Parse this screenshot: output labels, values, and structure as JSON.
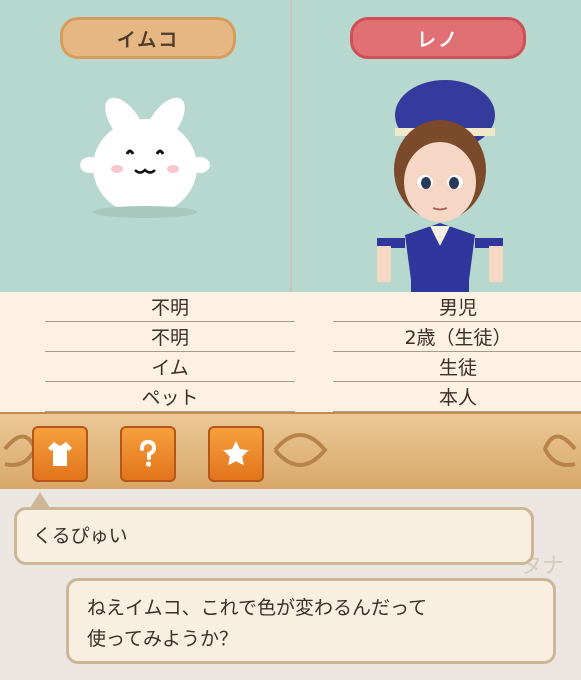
{
  "characters": {
    "left": {
      "name": "イムコ",
      "info": [
        "不明",
        "不明",
        "イム",
        "ペット"
      ]
    },
    "right": {
      "name": "レノ",
      "info": [
        "男児",
        "2歳（生徒）",
        "生徒",
        "本人"
      ]
    }
  },
  "toolbar": {
    "buttons": [
      {
        "name": "outfit-button",
        "icon": "shirt-icon"
      },
      {
        "name": "question-button",
        "icon": "question-icon"
      },
      {
        "name": "favorite-button",
        "icon": "star-icon"
      }
    ]
  },
  "chat": {
    "messages": [
      "くるぴゅい",
      "ねえイムコ、これで色が変わるんだって",
      "使ってみようか？"
    ],
    "watermark": "タナ"
  },
  "colors": {
    "panel_bg": "#b7d8ce",
    "left_pill": "#e6b783",
    "right_pill": "#e07073",
    "button": "#f09330",
    "toolbar": "#dcb27a"
  }
}
